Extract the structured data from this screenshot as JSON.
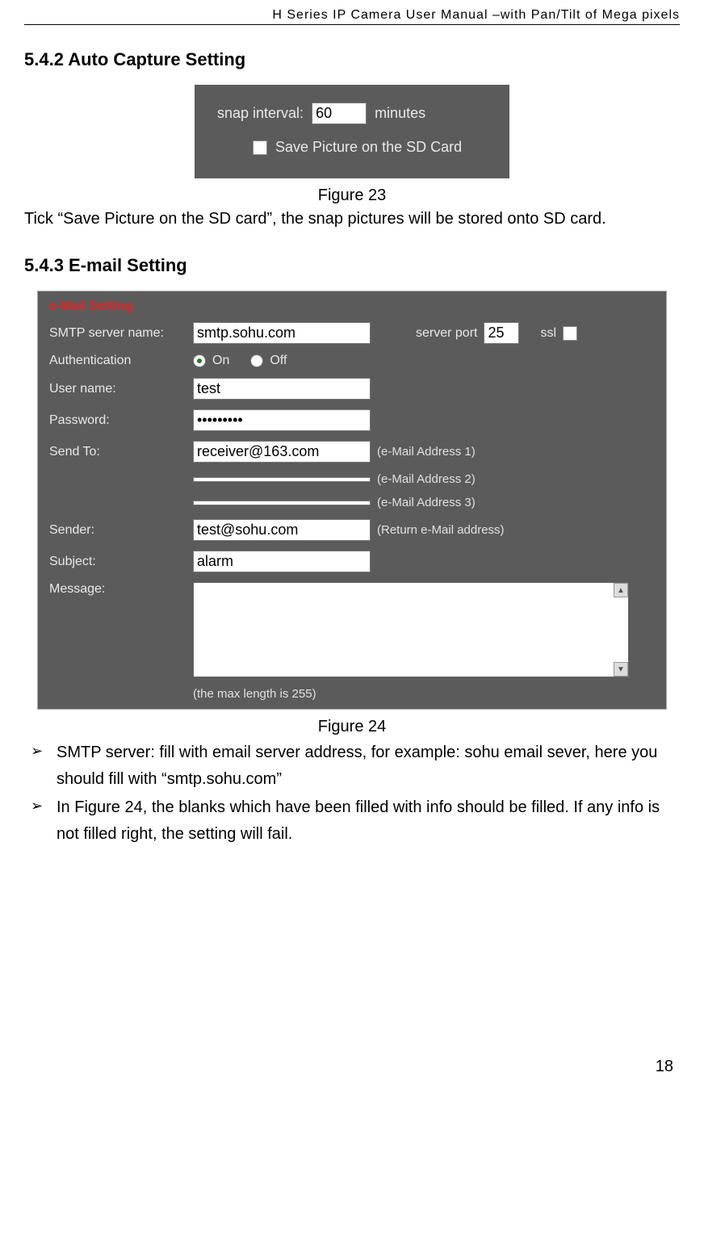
{
  "header": "H Series IP Camera User Manual –with Pan/Tilt of Mega pixels",
  "sections": {
    "s1_title": "5.4.2  Auto Capture Setting",
    "s2_title": "5.4.3  E-mail Setting"
  },
  "fig23": {
    "snap_interval_label": "snap interval:",
    "snap_interval_value": "60",
    "snap_interval_unit": "minutes",
    "save_sd_label": "Save Picture on the SD Card",
    "caption": "Figure 23"
  },
  "fig23_note": "Tick “Save Picture on the SD card”, the snap pictures will be stored onto SD card.",
  "fig24": {
    "title": "e-Mail Setting",
    "labels": {
      "smtp": "SMTP server name:",
      "server_port": "server port",
      "ssl": "ssl",
      "auth": "Authentication",
      "on": "On",
      "off": "Off",
      "user": "User name:",
      "pass": "Password:",
      "send_to": "Send To:",
      "addr1": "(e-Mail Address 1)",
      "addr2": "(e-Mail Address 2)",
      "addr3": "(e-Mail Address 3)",
      "sender": "Sender:",
      "return_addr": "(Return e-Mail address)",
      "subject": "Subject:",
      "message": "Message:",
      "maxlen": "(the max length is 255)"
    },
    "values": {
      "smtp": "smtp.sohu.com",
      "port": "25",
      "user": "test",
      "pass": "•••••••••",
      "sendto1": "receiver@163.com",
      "sendto2": "",
      "sendto3": "",
      "sender": "test@sohu.com",
      "subject": "alarm",
      "message": ""
    },
    "caption": "Figure 24"
  },
  "bullets": {
    "b1": "SMTP server: fill with email server address, for example: sohu email sever, here you should fill with “smtp.sohu.com”",
    "b2": "In Figure 24, the blanks which have been filled with info should be filled. If any info is not filled right, the setting will fail."
  },
  "page_number": "18"
}
